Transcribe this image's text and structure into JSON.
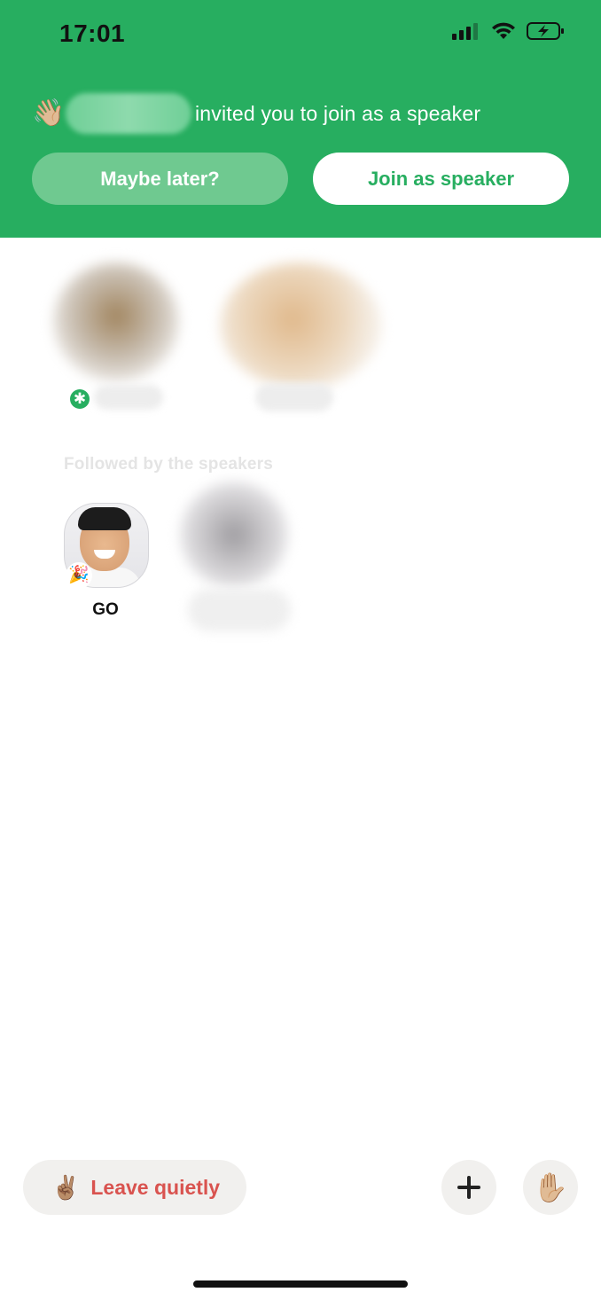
{
  "status_bar": {
    "time": "17:01"
  },
  "invite": {
    "wave_emoji": "👋🏼",
    "message": "invited you to join as a speaker",
    "maybe_later_label": "Maybe later?",
    "join_label": "Join as speaker"
  },
  "followed_section": {
    "title": "Followed by the speakers",
    "users": [
      {
        "name": "GO",
        "badge_emoji": "🎉"
      }
    ]
  },
  "bottom_bar": {
    "leave_emoji": "✌🏽",
    "leave_label": "Leave quietly",
    "add_icon": "plus-icon",
    "raise_hand_emoji": "✋🏼"
  },
  "colors": {
    "brand_green": "#27ae60",
    "leave_red": "#d9534f",
    "button_bg": "#f1f0ee"
  }
}
